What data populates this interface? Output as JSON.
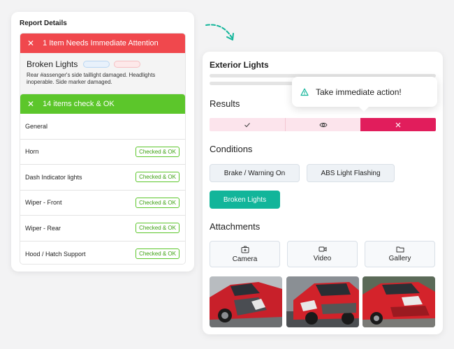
{
  "report": {
    "title": "Report Details",
    "attention": {
      "header": "1 Item Needs Immediate Attention",
      "item_title": "Broken Lights",
      "description": "Rear #assenger's side taillight damaged. Headlights inoperable. Side marker damaged."
    },
    "ok": {
      "header": "14 items check & OK",
      "rows": [
        {
          "label": "General",
          "badge": ""
        },
        {
          "label": "Horn",
          "badge": "Checked & OK"
        },
        {
          "label": "Dash Indicator lights",
          "badge": "Checked & OK"
        },
        {
          "label": "Wiper - Front",
          "badge": "Checked & OK"
        },
        {
          "label": "Wiper - Rear",
          "badge": "Checked & OK"
        },
        {
          "label": "Hood / Hatch Support",
          "badge": "Checked & OK"
        }
      ]
    }
  },
  "inspection": {
    "title": "Exterior Lights",
    "tooltip": "Take immediate action!",
    "results_label": "Results",
    "results": {
      "icons": [
        "check-icon",
        "eye-icon",
        "close-icon"
      ],
      "selected": "close"
    },
    "conditions_label": "Conditions",
    "conditions": [
      {
        "label": "Brake / Warning On",
        "active": false
      },
      {
        "label": "ABS Light Flashing",
        "active": false
      },
      {
        "label": "Broken Lights",
        "active": true
      }
    ],
    "attachments_label": "Attachments",
    "attachments": [
      {
        "label": "Camera",
        "icon": "camera-plus-icon"
      },
      {
        "label": "Video",
        "icon": "video-icon"
      },
      {
        "label": "Gallery",
        "icon": "folder-icon"
      }
    ]
  },
  "colors": {
    "attention_red": "#f0484d",
    "ok_green": "#5cc62b",
    "result_selected": "#e11d5c",
    "accent_teal": "#12b59a"
  }
}
